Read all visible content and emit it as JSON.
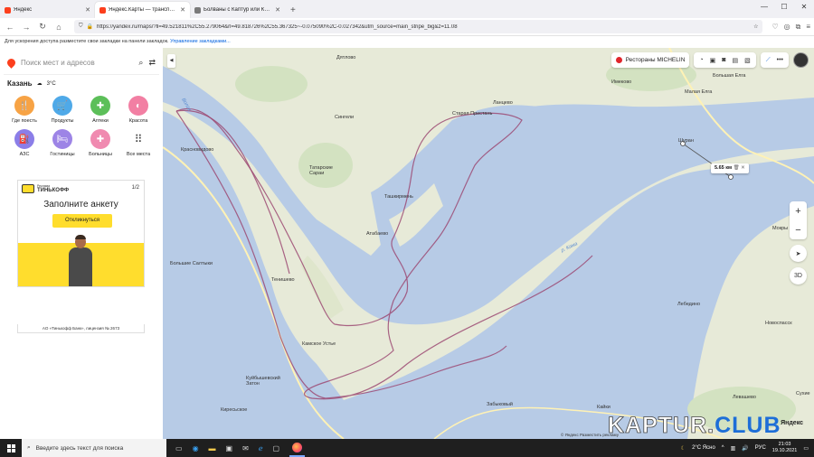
{
  "browser": {
    "tabs": [
      {
        "label": "Яндекс",
        "color": "#fc3f1d"
      },
      {
        "label": "Яндекс.Карты — транспорт, н",
        "color": "#fc3f1d"
      },
      {
        "label": "Болваны с Каптур или Крета",
        "color": "#7a7a7a"
      }
    ],
    "url": "https://yandex.ru/maps/?ll=49.521811%2C55.279064&rl=49.818726%2C55.367325~-0.075090%2C-0.027342&utm_source=main_stripe_big&z=11.08",
    "bookmarks_hint": "Для ускорения доступа разместите свои закладки на панели закладок.",
    "bookmarks_link": "Управление закладками..."
  },
  "sidebar": {
    "search_placeholder": "Поиск мест и адресов",
    "city": "Казань",
    "weather": "3°C",
    "categories": [
      {
        "label": "Где поесть",
        "color": "#f7a345",
        "icon": "fork-knife-icon",
        "glyph": "🍴"
      },
      {
        "label": "Продукты",
        "color": "#4fa9e8",
        "icon": "basket-icon",
        "glyph": "🛒"
      },
      {
        "label": "Аптеки",
        "color": "#5cbf59",
        "icon": "pharmacy-cross-icon",
        "glyph": "✚"
      },
      {
        "label": "Красота",
        "color": "#f27fa3",
        "icon": "beauty-icon",
        "glyph": "◐"
      },
      {
        "label": "АЗС",
        "color": "#8b7ee8",
        "icon": "fuel-icon",
        "glyph": "⛽"
      },
      {
        "label": "Гостиницы",
        "color": "#9d84e6",
        "icon": "bed-icon",
        "glyph": "🛏"
      },
      {
        "label": "Больницы",
        "color": "#f08ab0",
        "icon": "hospital-icon",
        "glyph": "✚"
      },
      {
        "label": "Все места",
        "color": "#ffffff",
        "icon": "grid-icon",
        "glyph": "⠿"
      }
    ],
    "ad": {
      "badge": "Реклама",
      "brand": "ТИНЬКОФФ",
      "counter": "1/2",
      "title": "Заполните анкету",
      "button": "Откликнуться",
      "footer": "АО «Тинькофф Банк», лицензия № 2673"
    }
  },
  "map": {
    "restaurants_chip": "Рестораны MICHELIN",
    "distance": "5.65 км",
    "layers_label": "3D",
    "copyright": "© Яндекс  Разместить рекламу",
    "brand": "Яндекс",
    "watermark_a": "KAPTUR.",
    "watermark_b": "CLUB",
    "colors": {
      "water": "#b7cbe6",
      "land": "#e7ead8",
      "route": "#9c4a73"
    },
    "places": [
      {
        "name": "Имеково",
        "river": false
      },
      {
        "name": "Большая Елга",
        "river": false
      },
      {
        "name": "Малая Елга",
        "river": false
      },
      {
        "name": "Шуран",
        "river": false
      },
      {
        "name": "Дятлово",
        "river": false
      },
      {
        "name": "Сингели",
        "river": false
      },
      {
        "name": "Старая Пристань",
        "river": false
      },
      {
        "name": "Ланцево",
        "river": false
      },
      {
        "name": "Красновидово",
        "river": false
      },
      {
        "name": "Татарские Сараи",
        "river": false
      },
      {
        "name": "Ташкирмень",
        "river": false
      },
      {
        "name": "Атабаево",
        "river": false
      },
      {
        "name": "Большие Салтыки",
        "river": false
      },
      {
        "name": "Тенишево",
        "river": false
      },
      {
        "name": "Камское Устье",
        "river": false
      },
      {
        "name": "Куйбышевский Затон",
        "river": false
      },
      {
        "name": "Киресьское",
        "river": false
      },
      {
        "name": "Лебедино",
        "river": false
      },
      {
        "name": "Новоспасск",
        "river": false
      },
      {
        "name": "Мокры",
        "river": false
      },
      {
        "name": "Сухие",
        "river": false
      },
      {
        "name": "Левашево",
        "river": false
      },
      {
        "name": "Кайки",
        "river": false
      },
      {
        "name": "Забыковый",
        "river": false
      },
      {
        "name": "р. Кама",
        "river": true
      },
      {
        "name": "Волга",
        "river": true
      }
    ]
  },
  "taskbar": {
    "search_placeholder": "Введите здесь текст для поиска",
    "weather": "2°C  Ясно",
    "lang": "РУС",
    "time": "21:03",
    "date": "19.10.2021"
  }
}
